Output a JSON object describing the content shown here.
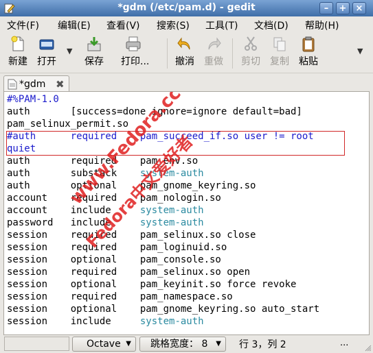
{
  "window": {
    "title": "*gdm (/etc/pam.d) - gedit",
    "icon": "gedit-pencil-icon",
    "controls": [
      "minimize-icon",
      "maximize-icon",
      "close-icon"
    ]
  },
  "menubar": [
    "文件(F)",
    "编辑(E)",
    "查看(V)",
    "搜索(S)",
    "工具(T)",
    "文档(D)",
    "帮助(H)"
  ],
  "toolbar": {
    "new": "新建",
    "open": "打开",
    "save": "保存",
    "print": "打印...",
    "undo": "撤消",
    "redo": "重做",
    "cut": "剪切",
    "copy": "复制",
    "paste": "粘贴"
  },
  "tab": {
    "label": "*gdm"
  },
  "editor": {
    "lines": [
      {
        "text": "#%PAM-1.0",
        "style": "comment"
      },
      {
        "text": "auth       [success=done ignore=ignore default=bad]",
        "style": "plain"
      },
      {
        "text": "pam_selinux_permit.so",
        "style": "plain"
      },
      {
        "text": "#auth      required    pam_succeed_if.so user != root",
        "style": "comment"
      },
      {
        "text": "quiet",
        "style": "comment"
      },
      {
        "text": "auth       required    pam_env.so",
        "style": "plain"
      },
      {
        "text": "auth       substack    ",
        "kw": "system-auth",
        "style": "mixed"
      },
      {
        "text": "auth       optional    pam_gnome_keyring.so",
        "style": "plain"
      },
      {
        "text": "account    required    pam_nologin.so",
        "style": "plain"
      },
      {
        "text": "account    include     ",
        "kw": "system-auth",
        "style": "mixed"
      },
      {
        "text": "password   include     ",
        "kw": "system-auth",
        "style": "mixed"
      },
      {
        "text": "session    required    pam_selinux.so close",
        "style": "plain"
      },
      {
        "text": "session    required    pam_loginuid.so",
        "style": "plain"
      },
      {
        "text": "session    optional    pam_console.so",
        "style": "plain"
      },
      {
        "text": "session    required    pam_selinux.so open",
        "style": "plain"
      },
      {
        "text": "session    optional    pam_keyinit.so force revoke",
        "style": "plain"
      },
      {
        "text": "session    required    pam_namespace.so",
        "style": "plain"
      },
      {
        "text": "session    optional    pam_gnome_keyring.so auto_start",
        "style": "plain"
      },
      {
        "text": "session    include     ",
        "kw": "system-auth",
        "style": "mixed"
      }
    ]
  },
  "watermark": {
    "line1": "www.Fedora.cc",
    "line2": "Fedora中文爱好者"
  },
  "statusbar": {
    "language": "Octave",
    "tab_width": "跳格宽度： 8",
    "position": "行 3，列 2",
    "overflow": "..."
  },
  "colors": {
    "comment": "#1a1acc",
    "keyword": "#2a8aa0",
    "highlight_border": "#d02626",
    "watermark": "#e02020"
  }
}
